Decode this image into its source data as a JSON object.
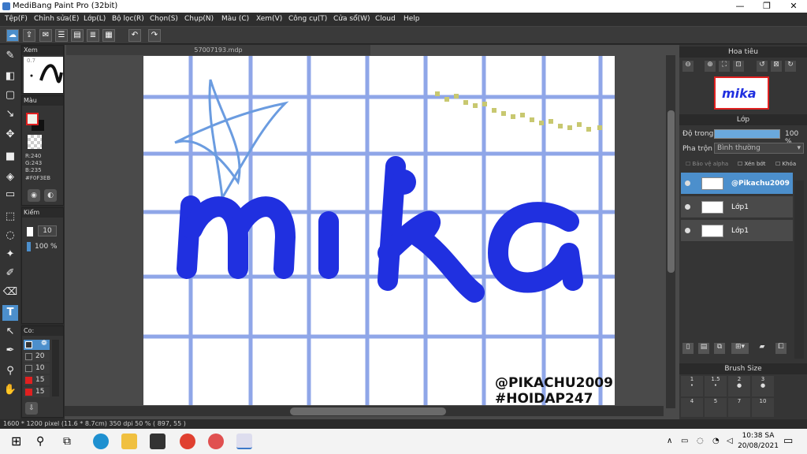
{
  "window": {
    "title": "MediBang Paint Pro (32bit)",
    "minimize": "—",
    "maximize": "❐",
    "close": "✕"
  },
  "menu": [
    "Tệp(F)",
    "Chỉnh sửa(E)",
    "Lớp(L)",
    "Bộ lọc(R)",
    "Chọn(S)",
    "Chụp(N)",
    "Màu (C)",
    "Xem(V)",
    "Công cụ(T)",
    "Cửa sổ(W)",
    "Cloud",
    "Help"
  ],
  "document_tab": "57007193.mdp",
  "panels": {
    "preview": "Xem",
    "preview_value": "0.7",
    "color": "Màu",
    "color_values": {
      "r": "R:240",
      "g": "G:243",
      "b": "B:235",
      "hex": "#F0F3EB"
    },
    "brush_ctrl": "Kiểm",
    "brush_size": "10",
    "brush_opacity": "100 %",
    "colorset": "Co:",
    "colorset_values": [
      "20",
      "10",
      "15",
      "15"
    ]
  },
  "navigator": {
    "title": "Hoa tiêu"
  },
  "layers": {
    "title": "Lớp",
    "opacity_label": "Độ trong",
    "opacity_value": "100 %",
    "blend_label": "Pha trộn",
    "blend_value": "Bình thường",
    "protect_alpha": "Bảo vệ alpha",
    "clipping": "Xén bớt",
    "lock": "Khóa",
    "items": [
      {
        "name": "@Pikachu2009"
      },
      {
        "name": "Lớp1"
      },
      {
        "name": "Lớp1"
      }
    ]
  },
  "brush_size_panel": {
    "title": "Brush Size",
    "sizes": [
      "1",
      "1.5",
      "2",
      "3",
      "4",
      "5",
      "7",
      "10"
    ]
  },
  "canvas": {
    "text_word": "mika",
    "signature_1": "@PIKACHU2009",
    "signature_2": "#HOIDAP247"
  },
  "status": "1600 * 1200 pixel   (11.6 * 8.7cm)   350 dpi   50 %   ( 897, 55 )",
  "taskbar": {
    "time": "10:38 SA",
    "date": "20/08/2021"
  },
  "colors": {
    "accent": "#4c8fcc",
    "grid": "#8fa6e8",
    "ink": "#2030e0",
    "ink_dark": "#1a22b8"
  }
}
